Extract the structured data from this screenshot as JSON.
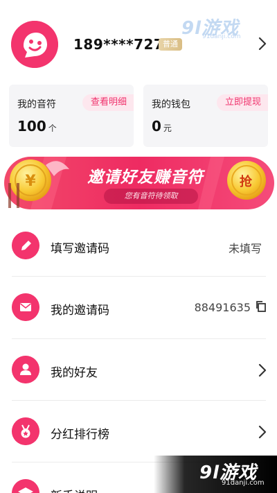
{
  "profile": {
    "phone": "189****7279",
    "level_badge": "普通"
  },
  "watermark": {
    "top_logo": "9l游戏",
    "top_url": "91danji.com",
    "bottom_logo": "9l游戏",
    "bottom_url": "91danji.com"
  },
  "cards": {
    "notes": {
      "title": "我的音符",
      "link": "查看明细",
      "value": "100",
      "unit": "个"
    },
    "wallet": {
      "title": "我的钱包",
      "link": "立即提现",
      "value": "0",
      "unit": "元"
    }
  },
  "banner": {
    "title": "邀请好友赚音符",
    "subtitle": "您有音符待领取",
    "coin_label": "抢",
    "coin_left_label": "¥"
  },
  "menu": {
    "items": [
      {
        "label": "填写邀请码",
        "value": "未填写",
        "icon": "pencil-icon"
      },
      {
        "label": "我的邀请码",
        "value": "88491635",
        "icon": "envelope-icon"
      },
      {
        "label": "我的好友",
        "value": "",
        "icon": "person-icon"
      },
      {
        "label": "分红排行榜",
        "value": "",
        "icon": "medal-icon"
      },
      {
        "label": "新手说明",
        "value": "",
        "icon": "graduation-cap-icon"
      }
    ]
  },
  "colors": {
    "accent": "#f3346d",
    "card_bg": "#f5f5f7",
    "link_bg": "#fde7ee",
    "badge_gold": "#d9bd84"
  }
}
